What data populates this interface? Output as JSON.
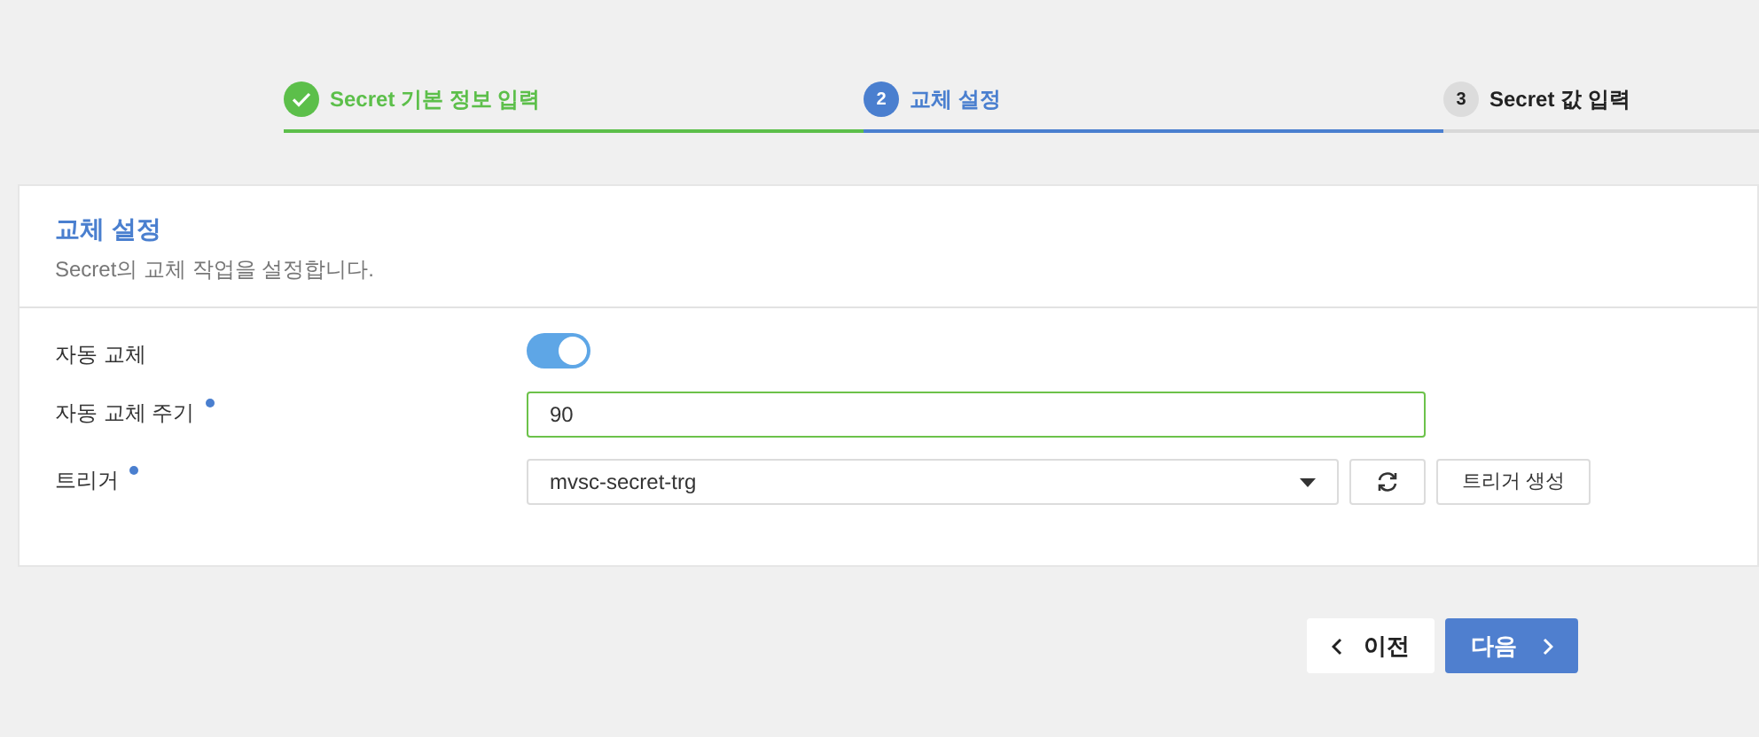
{
  "steps": [
    {
      "label": "Secret 기본 정보 입력",
      "completed": true,
      "selected": false
    },
    {
      "marker": "2",
      "label": "교체 설정",
      "completed": false,
      "selected": true
    },
    {
      "marker": "3",
      "label": "Secret 값 입력",
      "completed": false,
      "selected": false
    }
  ],
  "panel": {
    "title": "교체 설정",
    "description": "Secret의 교체 작업을 설정합니다."
  },
  "fields": [
    {
      "kind": "toggle",
      "label": "자동 교체",
      "required": false,
      "on": true
    },
    {
      "kind": "text",
      "label": "자동 교체 주기",
      "required": true,
      "value": "90",
      "valid": true
    },
    {
      "kind": "select",
      "label": "트리거",
      "required": true,
      "value": "mvsc-secret-trg",
      "action": "트리거 생성"
    }
  ],
  "footer": {
    "previous": "이전",
    "next": "다음"
  }
}
